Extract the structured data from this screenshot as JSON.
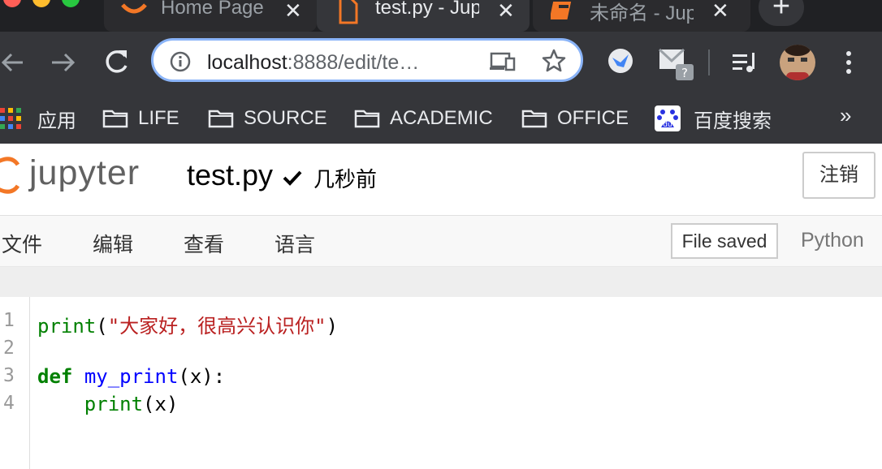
{
  "browser": {
    "tabs": [
      {
        "title": "Home Page",
        "close": "✕"
      },
      {
        "title": "test.py - Jupyter",
        "close": "✕"
      },
      {
        "title": "未命名 - Jupyter",
        "close": "✕"
      }
    ],
    "new_tab_label": "+",
    "url": {
      "host": "localhost",
      "path": ":8888/edit/te…"
    }
  },
  "bookmarks": {
    "apps_label": "应用",
    "items": [
      "LIFE",
      "SOURCE",
      "ACADEMIC",
      "OFFICE",
      "百度搜索"
    ],
    "overflow": "»"
  },
  "jupyter": {
    "logo_text": "jupyter",
    "filename": "test.py",
    "last_saved": "几秒前",
    "logout_label": "注销",
    "menu": [
      "文件",
      "编辑",
      "查看",
      "语言"
    ],
    "status": "File saved",
    "kernel": "Python"
  },
  "editor": {
    "line_numbers": [
      "1",
      "2",
      "3",
      "4"
    ],
    "code": {
      "line1": {
        "fn": "print",
        "open": "(",
        "string": "\"大家好，很高兴认识你\"",
        "close": ")"
      },
      "line3": {
        "kw": "def",
        "name": "my_print",
        "params": "(x):"
      },
      "line4": {
        "indent": "    ",
        "fn": "print",
        "args": "(x)"
      }
    }
  },
  "colors": {
    "tabstrip_bg": "#202124",
    "toolbar_bg": "#35363a",
    "omnibox_border": "#8ab4f8",
    "jupyter_orange": "#f37726",
    "keyword_green": "#008000",
    "string_red": "#ba2121",
    "def_blue": "#0000ff"
  },
  "icons": [
    "back-arrow-icon",
    "forward-arrow-icon",
    "reload-icon",
    "info-icon",
    "cast-icon",
    "star-icon",
    "extension-bird-icon",
    "gmail-checker-icon",
    "media-playlist-icon",
    "profile-avatar",
    "more-menu-icon",
    "apps-grid-icon",
    "folder-icon",
    "baidu-icon",
    "checkmark-icon"
  ]
}
